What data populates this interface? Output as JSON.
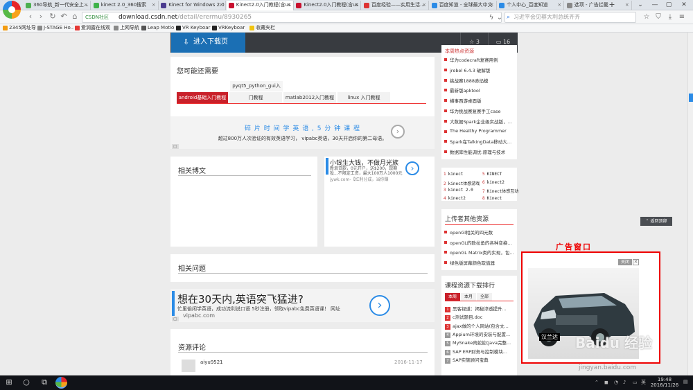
{
  "browser": {
    "tabs": [
      {
        "title": "360导航_新一代安全上网导航",
        "color": "#4caf50"
      },
      {
        "title": "kinect 2.0_360搜索",
        "color": "#3fb24a"
      },
      {
        "title": "Kinect for Windows 2.0",
        "color": "#4a3b8f"
      },
      {
        "title": "Kinect2.0入门教程(含us",
        "color": "#c8102e"
      },
      {
        "title": "Kinect2.0入门教程(含us",
        "color": "#c8102e"
      },
      {
        "title": "百度经验——实用生活指南",
        "color": "#d33"
      },
      {
        "title": "百度知道 - 全球最大中文",
        "color": "#2b8be6"
      },
      {
        "title": "个人中心_百度知道",
        "color": "#2b8be6"
      },
      {
        "title": "选项 - 广告拦截",
        "color": "#888"
      }
    ],
    "new_tab": "+",
    "window_controls": [
      "⌄",
      "—",
      "▢",
      "✕"
    ],
    "url_badge": "CSDN社区",
    "url_host": "download.csdn.net",
    "url_path": "/detail/erermu/8930265",
    "search_placeholder": "习近平会见蔡大利总统齐齐",
    "bookmarks": [
      {
        "label": "2345网址导",
        "color": "#f39c12"
      },
      {
        "label": "J-STAGE Ho..",
        "color": "#888"
      },
      {
        "label": "爱润露在线观",
        "color": "#e53935"
      },
      {
        "label": "上网导航",
        "color": "#888"
      },
      {
        "label": "Leap Motio",
        "color": "#555"
      },
      {
        "label": "VR Keyboar",
        "color": "#222"
      },
      {
        "label": "VRKeyboar",
        "color": "#222"
      },
      {
        "label": "收藏夹栏",
        "color": "#f1c40f"
      }
    ]
  },
  "page": {
    "download_button": "进入下载页",
    "stats": {
      "stars": "3",
      "comments": "16"
    },
    "may_need": {
      "title": "您可能还需要",
      "popover": "pyqt5_python_gui入",
      "tabs": [
        "android基础入门教程",
        "门教程",
        "matlab2012入门教程",
        "linux 入门教程"
      ]
    },
    "ad1": {
      "title": "碎 片 时 间 学 英 语 , 5 分 钟 课 程",
      "text": "超过800万人次验证的有效英语学习， vipabc英语，30天开启你的第二母语。"
    },
    "related_blog": {
      "title": "相关博文"
    },
    "ad2": {
      "title": "小钱生大钱，不做月光族",
      "text": "新浪贷款，0元开户，送$200，现期投...不限定工资，最大100万人1000元",
      "site": "jywk.com-【红利分成，当你赚"
    },
    "related_questions": {
      "title": "相关问题"
    },
    "ad3": {
      "title": "想在30天内,英语突飞猛进?",
      "text": "忙里偷闲学英语，成功流利说口语 5秒注册，领取vipabc免费英语课！ 网址",
      "site": "vipabc.com"
    },
    "comments": {
      "title": "资源评论",
      "user": "aiyu9521",
      "date": "2016-11-17"
    },
    "sidebar_list1": {
      "title": "本周热点资源",
      "items": [
        "华为codecraft复赛用例",
        "jrebel 6.4.3 破解版",
        "挑战赛1888赤焰模",
        "最新版apktool",
        "横事西游桌面版",
        "华为挑战赛复赛手工case",
        "大数据Spark企业级实战版，完...",
        "The Healthy Programmer",
        "Spark在TalkingData移动大数据...",
        "数据库性能调优:原理与技术"
      ]
    },
    "keywords": [
      "kinect",
      "kinect体感游戏",
      "kinect 2.0",
      "kinect2",
      "KINECT",
      "kinect2",
      "Kinect体感互动",
      "Kinect"
    ],
    "uploader_other": {
      "title": "上传者其他资源",
      "items": [
        "openGl相关的四元数 ",
        "openGL的欧拉角的各种变换实...",
        "openGL Matrix类的实现，包括...",
        "绿色版屏幕颜色取值器"
      ]
    },
    "ad_window_label": "广告窗口",
    "ad_close": "关闭",
    "ad_car_caption": "汉兰达",
    "back_to_top": "返回顶部",
    "course_rank": {
      "title": "课程资源下载排行",
      "tabs": [
        "本周",
        "本月",
        "全部"
      ],
      "items": [
        "黑客视道：揭秘渗透提升...",
        "c测试题目.doc",
        "ajax做的个人网站(包含文...",
        "Appium环境的安装与配置...",
        "MySnake肉蛇蛇(Java完整...",
        "SAP ERP财务与控制模块...",
        "SAP实施顾问宝典"
      ]
    }
  },
  "watermark": {
    "brand": "Baidu 经验",
    "url": "jingyan.baidu.com"
  },
  "taskbar": {
    "start": "⊞",
    "search": "○",
    "taskview": "⧉",
    "time": "19:48",
    "date": "2016/11/26",
    "lang": "英"
  }
}
